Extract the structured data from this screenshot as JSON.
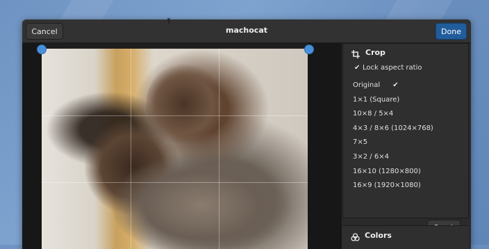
{
  "header": {
    "title": "machocat",
    "cancel_label": "Cancel",
    "done_label": "Done"
  },
  "sidebar": {
    "crop_title": "Crop",
    "lock_label": "Lock aspect ratio",
    "lock_checked": true,
    "ratios": [
      {
        "label": "Original",
        "selected": true
      },
      {
        "label": "1×1 (Square)",
        "selected": false
      },
      {
        "label": "10×8 / 5×4",
        "selected": false
      },
      {
        "label": "4×3 / 8×6 (1024×768)",
        "selected": false
      },
      {
        "label": "7×5",
        "selected": false
      },
      {
        "label": "3×2 / 6×4",
        "selected": false
      },
      {
        "label": "16×10 (1280×800)",
        "selected": false
      },
      {
        "label": "16×9 (1920×1080)",
        "selected": false
      }
    ],
    "reset_label": "Reset",
    "colors_title": "Colors"
  },
  "icons": {
    "crop": "crop-icon",
    "check": "checkmark-icon",
    "colors": "colors-icon",
    "cursor": "move-cursor-icon"
  },
  "colors": {
    "accent": "#215d9c",
    "handle": "#4a90d9"
  }
}
